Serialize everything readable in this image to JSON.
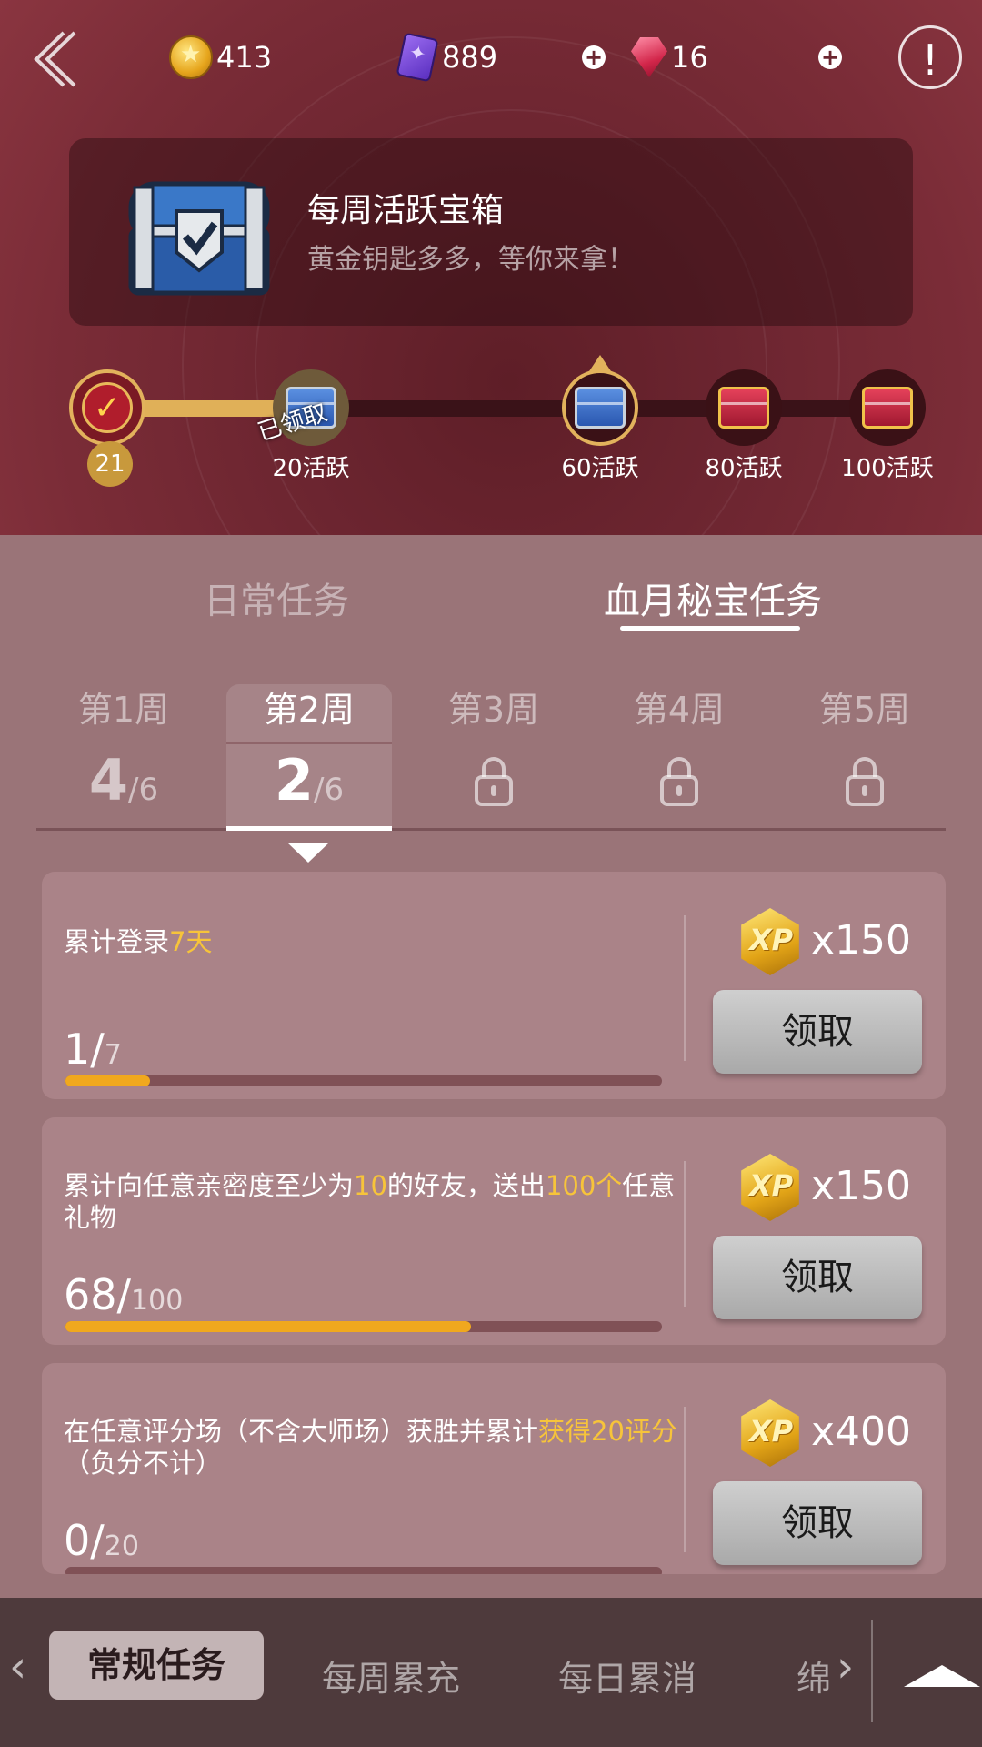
{
  "currencies": [
    {
      "icon": "gold-coin-icon",
      "value": "413"
    },
    {
      "icon": "purple-card-icon",
      "value": "889"
    },
    {
      "icon": "red-gem-icon",
      "value": "16"
    }
  ],
  "chest": {
    "title": "每周活跃宝箱",
    "subtitle": "黄金钥匙多多，等你来拿！"
  },
  "activity": {
    "current": "21",
    "progress_fraction": 0.22,
    "claimed_stamp": "已领取",
    "milestones": [
      {
        "label": "20活跃",
        "state": "claimed"
      },
      {
        "label": "60活跃",
        "state": "current"
      },
      {
        "label": "80活跃",
        "state": "locked"
      },
      {
        "label": "100活跃",
        "state": "locked"
      }
    ]
  },
  "main_tabs": [
    {
      "label": "日常任务",
      "active": false
    },
    {
      "label": "血月秘宝任务",
      "active": true
    }
  ],
  "weeks": [
    {
      "label": "第1周",
      "done": "4",
      "total": "/6",
      "locked": false
    },
    {
      "label": "第2周",
      "done": "2",
      "total": "/6",
      "locked": false,
      "selected": true
    },
    {
      "label": "第3周",
      "locked": true
    },
    {
      "label": "第4周",
      "locked": true
    },
    {
      "label": "第5周",
      "locked": true
    }
  ],
  "tasks": [
    {
      "desc_parts": [
        "累计登录",
        "7天"
      ],
      "current": "1/",
      "total": "7",
      "fraction": 0.142,
      "reward": "x150",
      "button": "领取"
    },
    {
      "desc_parts": [
        "累计向任意亲密度至少为",
        "10",
        "的好友，送出",
        "100个",
        "任意礼物"
      ],
      "current": "68/",
      "total": "100",
      "fraction": 0.68,
      "reward": "x150",
      "button": "领取"
    },
    {
      "desc_parts": [
        "在任意评分场（不含大师场）获胜并累计",
        "获得20评分",
        "（负分不计）"
      ],
      "current": "0/",
      "total": "20",
      "fraction": 0,
      "reward": "x400",
      "button": "领取"
    }
  ],
  "bottom_tabs": [
    {
      "label": "常规任务",
      "active": true
    },
    {
      "label": "每周累充",
      "active": false
    },
    {
      "label": "每日累消",
      "active": false
    },
    {
      "label": "绵",
      "active": false
    }
  ],
  "colors": {
    "highlight": "#f7c43a",
    "progress": "#f0a81e",
    "banner": "#6c2530"
  }
}
